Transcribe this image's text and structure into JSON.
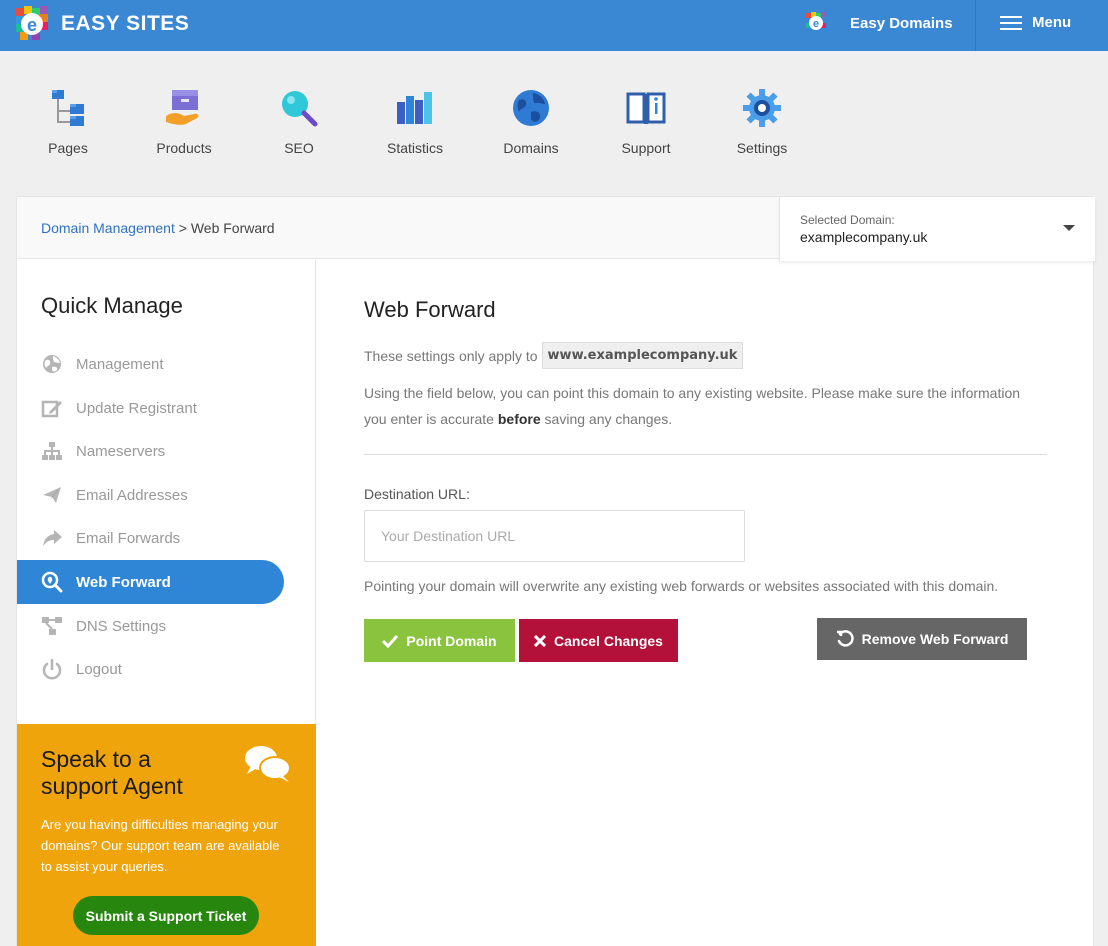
{
  "header": {
    "brand": "EASY SITES",
    "domains_link": "Easy Domains",
    "menu_label": "Menu",
    "colors": {
      "bar": "#3a87d4"
    }
  },
  "nav": [
    {
      "label": "Pages",
      "icon": "pages-icon"
    },
    {
      "label": "Products",
      "icon": "products-icon"
    },
    {
      "label": "SEO",
      "icon": "seo-icon"
    },
    {
      "label": "Statistics",
      "icon": "statistics-icon"
    },
    {
      "label": "Domains",
      "icon": "domains-icon"
    },
    {
      "label": "Support",
      "icon": "support-icon"
    },
    {
      "label": "Settings",
      "icon": "settings-icon"
    }
  ],
  "breadcrumb": {
    "parent": "Domain Management",
    "separator": ">",
    "current": "Web Forward"
  },
  "domain_selector": {
    "label": "Selected Domain:",
    "value": "examplecompany.uk"
  },
  "sidebar": {
    "title": "Quick Manage",
    "items": [
      {
        "label": "Management",
        "icon": "globe-icon",
        "active": false
      },
      {
        "label": "Update Registrant",
        "icon": "edit-icon",
        "active": false
      },
      {
        "label": "Nameservers",
        "icon": "sitemap-icon",
        "active": false
      },
      {
        "label": "Email Addresses",
        "icon": "paper-plane-icon",
        "active": false
      },
      {
        "label": "Email Forwards",
        "icon": "share-arrow-icon",
        "active": false
      },
      {
        "label": "Web Forward",
        "icon": "search-location-icon",
        "active": true
      },
      {
        "label": "DNS Settings",
        "icon": "network-icon",
        "active": false
      },
      {
        "label": "Logout",
        "icon": "power-icon",
        "active": false
      }
    ]
  },
  "support_box": {
    "title": "Speak to a support Agent",
    "text": "Are you having difficulties managing your domains? Our support team are available to assist your queries.",
    "button": "Submit a Support Ticket",
    "colors": {
      "background": "#f0a40c",
      "button": "#27860e"
    }
  },
  "content": {
    "title": "Web Forward",
    "settings_prefix": "These settings only apply to",
    "domain_code": "www.examplecompany.uk",
    "desc_before": "Using the field below, you can point this domain to any existing website. Please make sure the information you enter is accurate ",
    "desc_bold": "before",
    "desc_after": " saving any changes.",
    "dest_label": "Destination URL:",
    "dest_placeholder": "Your Destination URL",
    "dest_value": "",
    "note": "Pointing your domain will overwrite any existing web forwards or websites associated with this domain.",
    "buttons": {
      "point": "Point Domain",
      "cancel": "Cancel Changes",
      "remove": "Remove Web Forward"
    },
    "colors": {
      "point": "#8ac43f",
      "cancel": "#b3103a",
      "remove": "#666666"
    }
  }
}
